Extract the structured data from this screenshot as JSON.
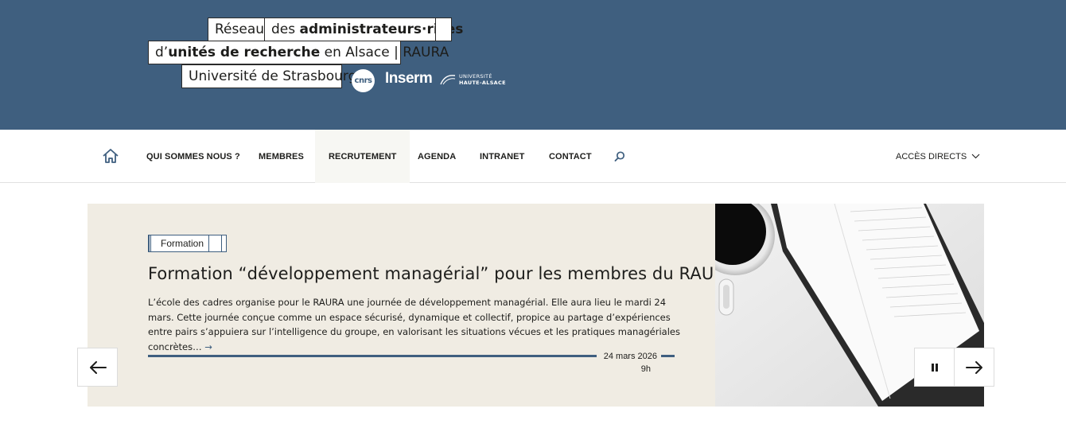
{
  "header": {
    "logo": {
      "line1_part1": "Réseau",
      "line1_part2_normal": "des ",
      "line1_part2_bold": "administrateurs·rices",
      "line2_prefix": "d’",
      "line2_bold": "unités de recherche",
      "line2_suffix": " en Alsace | RAURA",
      "line3": "Université de Strasbourg"
    },
    "partners": {
      "cnrs": "cnrs",
      "inserm": "Inserm",
      "uha_line1": "UNIVERSITÉ",
      "uha_line2": "HAUTE-ALSACE"
    },
    "background_color": "#3f5f7f"
  },
  "nav": {
    "home_icon": "home-icon",
    "items": [
      {
        "label": "QUI SOMMES NOUS ?"
      },
      {
        "label": "MEMBRES"
      },
      {
        "label": "RECRUTEMENT"
      },
      {
        "label": "AGENDA"
      },
      {
        "label": "INTRANET"
      },
      {
        "label": "CONTACT"
      }
    ],
    "search_icon": "search-icon",
    "access_label": "ACCÈS DIRECTS",
    "access_icon": "chevron-down-icon"
  },
  "slide": {
    "tag": "Formation",
    "title": "Formation “développement managérial” pour les membres du RAURA",
    "description": "L’école des cadres organise pour le RAURA une journée de développement managérial. Elle aura lieu le mardi 24 mars. Cette journée conçue comme un espace sécurisé, dynamique et collectif, propice au partage d’expériences entre pairs s’appuiera sur l’intelligence du groupe, en valorisant les situations vécues et les pratiques managériales concrètes…",
    "more_arrow": "→",
    "date": "24 mars 2026",
    "time": "9h",
    "background_color": "#f0ece3",
    "accent_color": "#3f5f7f"
  },
  "controls": {
    "prev_icon": "arrow-left-icon",
    "pause_icon": "pause-icon",
    "next_icon": "arrow-right-icon"
  }
}
